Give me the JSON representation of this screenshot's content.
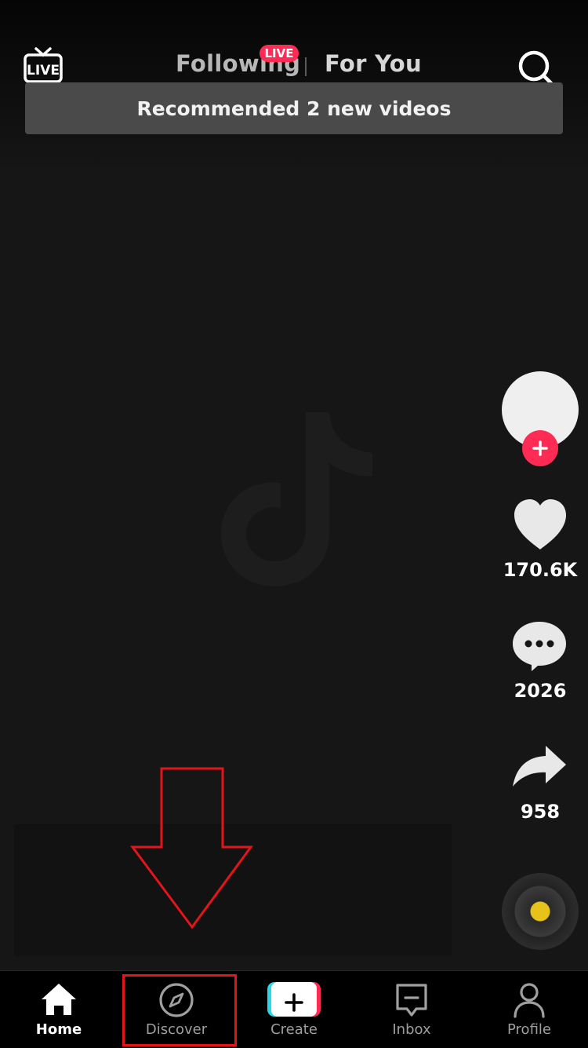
{
  "header": {
    "live_label": "LIVE",
    "tabs": [
      {
        "label": "Following",
        "badge": "LIVE"
      },
      {
        "label": "For You"
      }
    ]
  },
  "banner": {
    "text": "Recommended 2 new videos"
  },
  "right_rail": {
    "likes": "170.6K",
    "comments": "2026",
    "shares": "958"
  },
  "bottom_nav": {
    "items": [
      {
        "label": "Home",
        "icon": "home-icon",
        "active": true
      },
      {
        "label": "Discover",
        "icon": "compass-icon"
      },
      {
        "label": "Create",
        "icon": "plus-icon"
      },
      {
        "label": "Inbox",
        "icon": "inbox-icon"
      },
      {
        "label": "Profile",
        "icon": "person-icon"
      }
    ]
  },
  "colors": {
    "accent": "#fe2c55",
    "cyan": "#29d7e6",
    "annotation": "#e3151b"
  }
}
